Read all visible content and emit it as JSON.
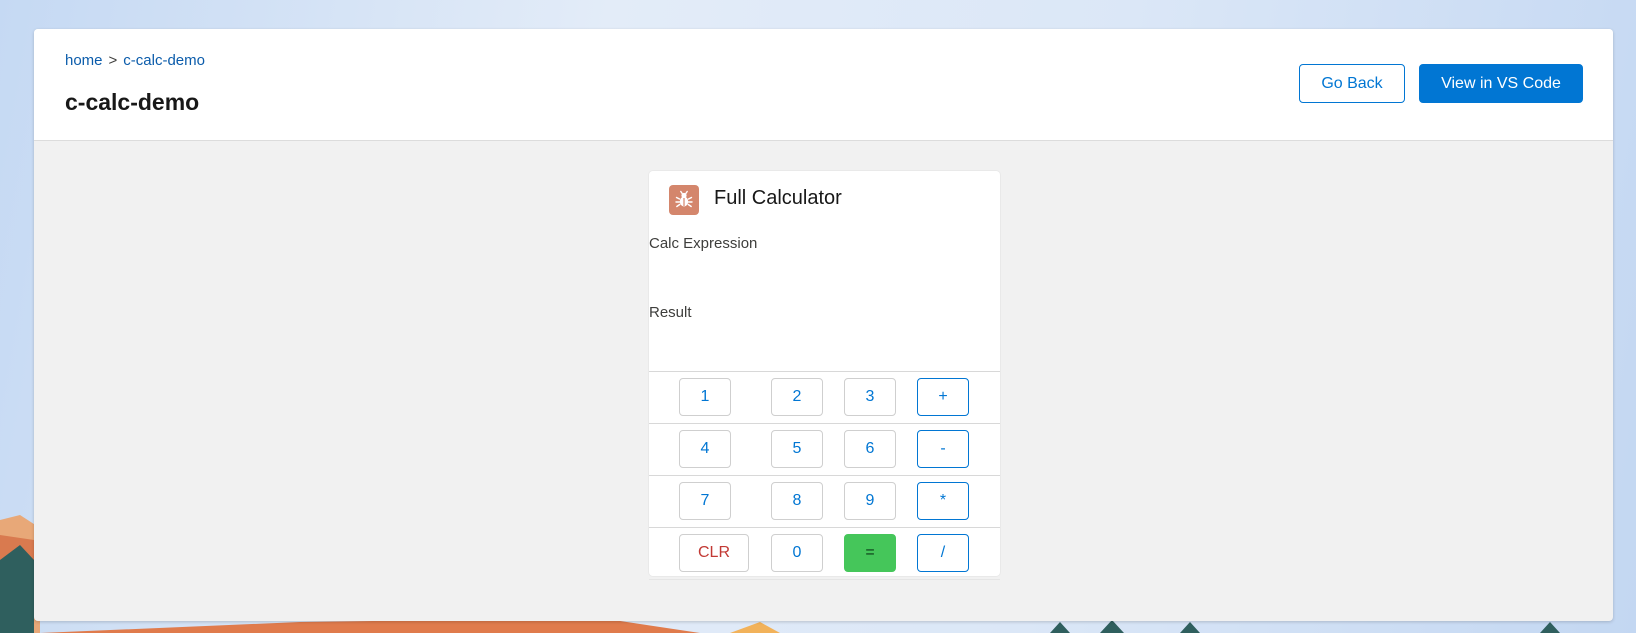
{
  "breadcrumb": {
    "home": "home",
    "separator": ">",
    "current": "c-calc-demo"
  },
  "header": {
    "title": "c-calc-demo",
    "go_back": "Go Back",
    "view_code": "View in VS Code"
  },
  "card": {
    "icon": "bug-icon",
    "icon_color": "#d4866c",
    "title": "Full Calculator",
    "expression_label": "Calc Expression",
    "expression_value": "",
    "result_label": "Result",
    "result_value": ""
  },
  "keypad": {
    "rows": [
      [
        "1",
        "2",
        "3",
        "+"
      ],
      [
        "4",
        "5",
        "6",
        "-"
      ],
      [
        "7",
        "8",
        "9",
        "*"
      ],
      [
        "CLR",
        "0",
        "=",
        "/"
      ]
    ]
  },
  "colors": {
    "brand": "#0176d3",
    "equals": "#45c65a",
    "clear": "#c23934"
  }
}
